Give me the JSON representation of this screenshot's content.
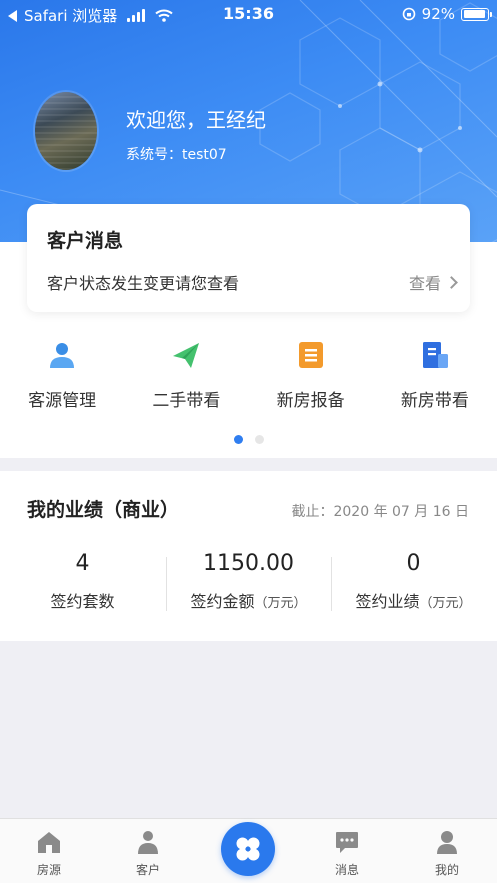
{
  "status_bar": {
    "back_app": "Safari 浏览器",
    "time": "15:36",
    "battery": "92%"
  },
  "profile": {
    "welcome": "欢迎您，王经纪",
    "system_no": "系统号：test07"
  },
  "message_card": {
    "title": "客户消息",
    "text": "客户状态发生变更请您查看",
    "view_label": "查看"
  },
  "shortcuts": [
    {
      "label": "客源管理",
      "icon": "person-icon",
      "color": "#3a8ee6"
    },
    {
      "label": "二手带看",
      "icon": "paper-plane-icon",
      "color": "#44c16e"
    },
    {
      "label": "新房报备",
      "icon": "document-icon",
      "color": "#f39a2c"
    },
    {
      "label": "新房带看",
      "icon": "building-icon",
      "color": "#2f6fe0"
    }
  ],
  "pagination": {
    "pages": 2,
    "active": 1
  },
  "performance": {
    "title": "我的业绩（商业）",
    "date": "截止：2020 年 07 月 16 日",
    "stats": [
      {
        "value": "4",
        "label": "签约套数",
        "unit": ""
      },
      {
        "value": "1150.00",
        "label": "签约金额",
        "unit": "（万元）"
      },
      {
        "value": "0",
        "label": "签约业绩",
        "unit": "（万元）"
      }
    ]
  },
  "tabbar": {
    "items": [
      {
        "label": "房源",
        "icon": "house-icon"
      },
      {
        "label": "客户",
        "icon": "user-icon"
      },
      {
        "label": "消息",
        "icon": "chat-icon"
      },
      {
        "label": "我的",
        "icon": "profile-icon"
      }
    ],
    "center_icon": "clover-icon"
  },
  "colors": {
    "brand": "#2a79ed",
    "header_top": "#2a77ea",
    "header_bottom": "#5aa2f7"
  }
}
